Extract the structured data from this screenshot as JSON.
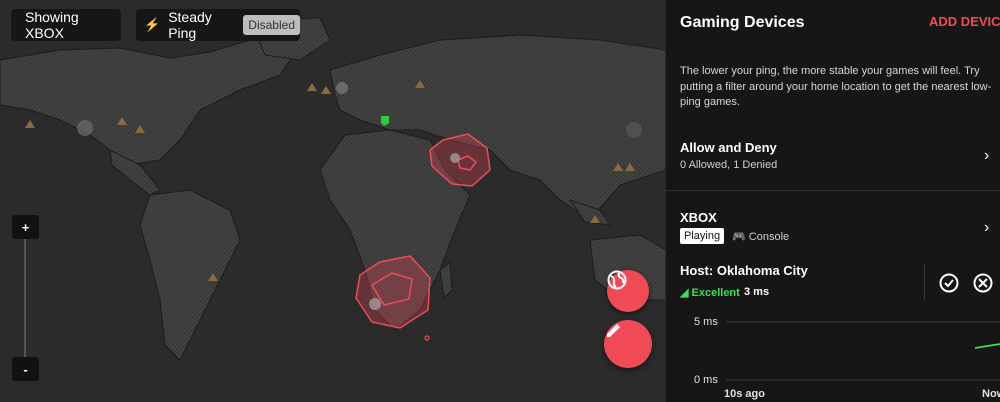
{
  "map": {
    "filter_label": "Showing XBOX",
    "steady_ping_label": "Steady Ping",
    "steady_ping_status": "Disabled",
    "zoom_in": "+",
    "zoom_out": "-",
    "accent": "#f04a57"
  },
  "panel": {
    "title": "Gaming Devices",
    "add_device": "ADD DEVICE",
    "description": "The lower your ping, the more stable your games will feel. Try putting a filter around your home location to get the nearest low-ping games.",
    "allow_deny": {
      "title": "Allow and Deny",
      "sub": "0 Allowed, 1 Denied"
    },
    "device": {
      "name": "XBOX",
      "status": "Playing",
      "type": "Console"
    },
    "host": {
      "label": "Host: Oklahoma City",
      "quality": "Excellent",
      "ping": "3 ms",
      "quality_color": "#3ddc5a"
    },
    "graph": {
      "y_top": "5 ms",
      "y_bottom": "0 ms",
      "x_left": "10s ago",
      "x_right": "Now"
    }
  }
}
